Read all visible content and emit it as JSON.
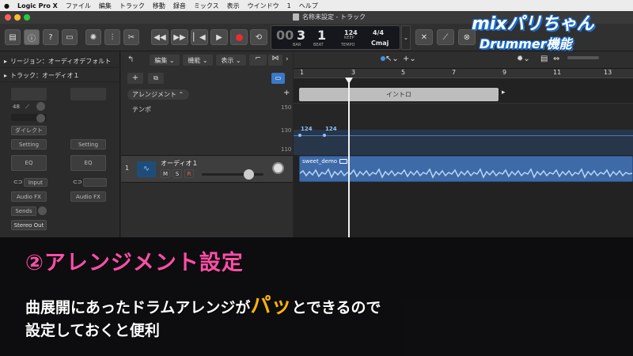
{
  "menubar": {
    "app": "Logic Pro X",
    "items": [
      "ファイル",
      "編集",
      "トラック",
      "移動",
      "録音",
      "ミックス",
      "表示",
      "ウインドウ",
      "1",
      "ヘルプ"
    ]
  },
  "window": {
    "title": "名称未設定 - トラック"
  },
  "lcd": {
    "bar": "3",
    "beat": "1",
    "bar_label": "BAR",
    "beat_label": "BEAT",
    "tempo": "124",
    "keep": "KEEP",
    "tempo_label": "TEMPO",
    "signature": "4/4",
    "key": "Cmaj",
    "leading_digit": "00"
  },
  "inspector": {
    "region": "リージョン：オーディオデフォルト",
    "track": "トラック：オーディオ１",
    "value_48": "48",
    "direct": "ダイレクト",
    "setting": "Setting",
    "eq": "EQ",
    "input": "Input",
    "audio_fx": "Audio FX",
    "sends": "Sends",
    "stereo_out": "Stereo Out"
  },
  "tracks_toolbar": {
    "edit": "編集",
    "function": "機能",
    "view": "表示"
  },
  "global": {
    "arrangement": "アレンジメント",
    "tempo": "テンポ",
    "tempo_ticks": [
      "150",
      "130",
      "110"
    ],
    "intro": "イントロ",
    "tempo_values": [
      "124",
      "124"
    ]
  },
  "ruler": [
    "1",
    "3",
    "5",
    "7",
    "9",
    "11",
    "13"
  ],
  "track": {
    "number": "1",
    "name": "オーディオ１",
    "m": "M",
    "s": "S",
    "r": "R",
    "region_name": "sweet_demo"
  },
  "caption": {
    "heading": "②アレンジメント設定",
    "line1_pre": "曲展開にあったドラムアレンジが",
    "line1_highlight": "パッ",
    "line1_post": "とできるので",
    "line2": "設定しておくと便利"
  },
  "logo": {
    "line1": "mixパリちゃん",
    "line2": "Drummer機能"
  },
  "colors": {
    "accent_pink": "#ff4fa8",
    "highlight": "#ffb400",
    "region_blue": "#3e6aa8",
    "record": "#e0302f"
  }
}
